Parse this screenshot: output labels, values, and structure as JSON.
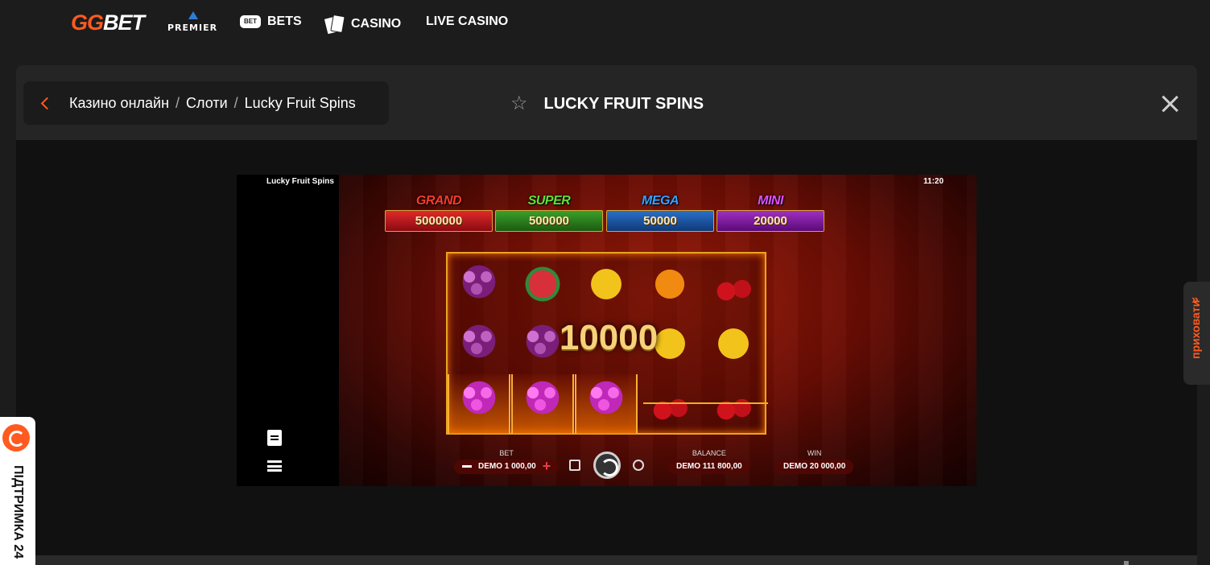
{
  "header": {
    "logo": {
      "gg": "GG",
      "bet": "BET"
    },
    "premier_label": "PREMIER",
    "nav": [
      {
        "icon": "bets-icon",
        "icon_text": "BET",
        "label": "BETS"
      },
      {
        "icon": "casino-cards-icon",
        "label": "CASINO"
      },
      {
        "icon": "",
        "label": "LIVE CASINO"
      }
    ]
  },
  "breadcrumb": {
    "items": [
      "Казино онлайн",
      "Слоти",
      "Lucky Fruit Spins"
    ],
    "separator": "/"
  },
  "game_title": "LUCKY FRUIT SPINS",
  "game": {
    "name": "Lucky Fruit Spins",
    "time": "11:20",
    "jackpots": [
      {
        "label": "GRAND",
        "value": "5000000",
        "color": "#c8141e",
        "label_color": "#ff3a2a"
      },
      {
        "label": "SUPER",
        "value": "500000",
        "color": "#2e8a1c",
        "label_color": "#5ee23a"
      },
      {
        "label": "MEGA",
        "value": "50000",
        "color": "#1a5fb0",
        "label_color": "#3aa0ff"
      },
      {
        "label": "MINI",
        "value": "20000",
        "color": "#8a1aa0",
        "label_color": "#e050ff"
      }
    ],
    "win_amount": "10000",
    "reels": [
      [
        "grape",
        "melon",
        "lemon",
        "orange",
        "cherry"
      ],
      [
        "grape",
        "grape",
        "blank",
        "lemon",
        "lemon"
      ],
      [
        "grape-hot",
        "grape-hot",
        "grape-hot",
        "cherry",
        "cherry"
      ]
    ],
    "hud": {
      "bet_caption": "BET",
      "bet_value": "DEMO 1 000,00",
      "balance_caption": "BALANCE",
      "balance_value": "DEMO 111 800,00",
      "win_caption": "WIN",
      "win_value": "DEMO 20 000,00"
    }
  },
  "side": {
    "hide_label": "приховати",
    "support_label": "ПІДТРИМКА 24"
  },
  "colors": {
    "accent": "#ff5a1f",
    "background": "#1c1c1c",
    "panel": "#252525"
  }
}
